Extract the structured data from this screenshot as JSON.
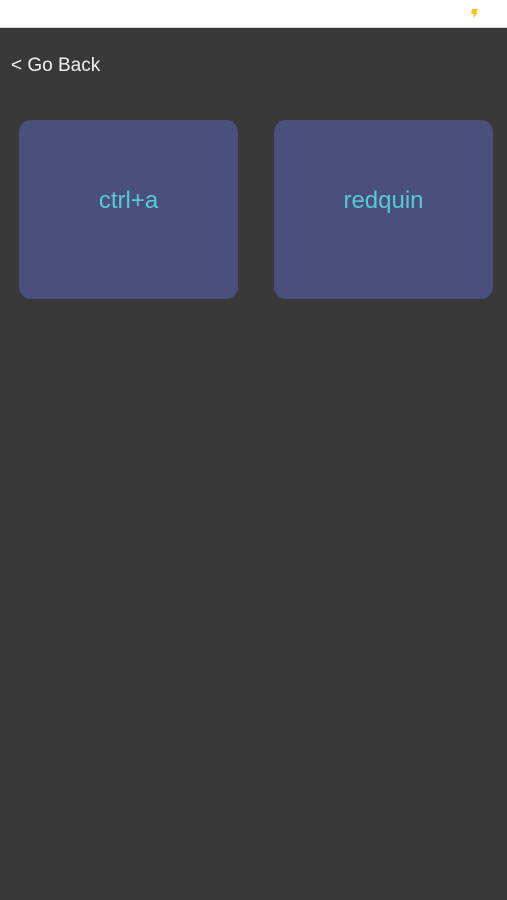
{
  "status_bar": {
    "icon": "battery-icon",
    "icon_color": "#f5c518",
    "background": "#ffffff"
  },
  "nav": {
    "back_label": "< Go Back"
  },
  "tiles": [
    {
      "label": "ctrl+a"
    },
    {
      "label": "redquin"
    }
  ],
  "colors": {
    "background": "#393939",
    "tile_background": "#4a4f7d",
    "tile_text": "#56c9d8",
    "back_text": "#f2f2f2"
  }
}
